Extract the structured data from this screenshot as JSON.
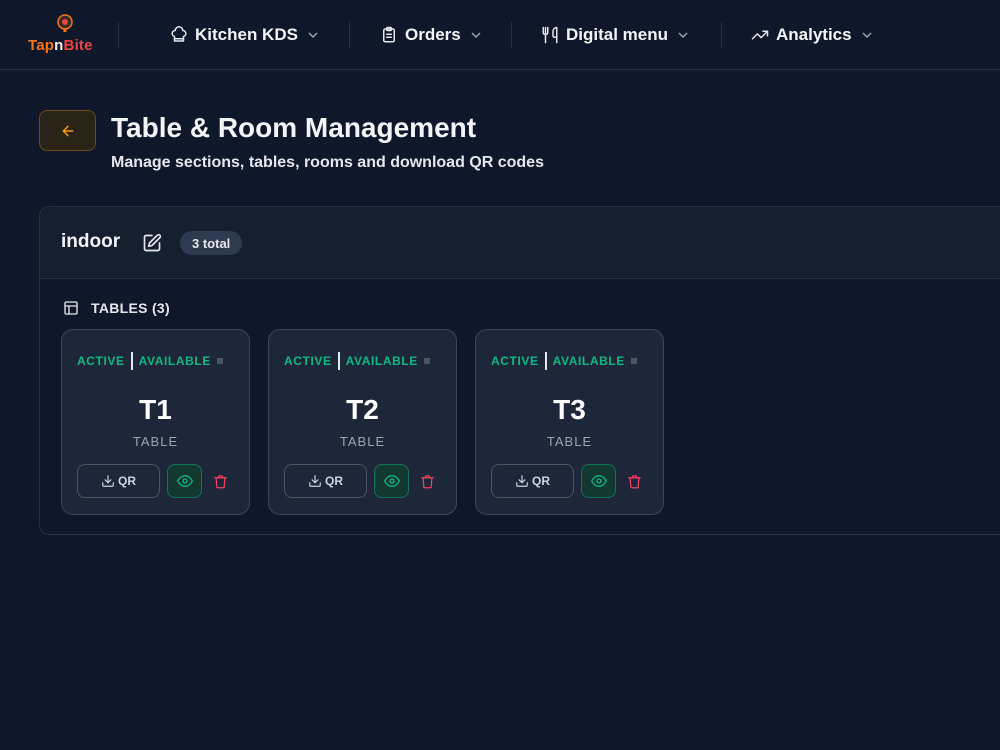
{
  "nav": {
    "logo": {
      "part1": "Tap",
      "part2": "n",
      "part3": "Bite"
    },
    "items": [
      {
        "label": "Kitchen KDS",
        "icon": "chef-hat-icon"
      },
      {
        "label": "Orders",
        "icon": "clipboard-icon"
      },
      {
        "label": "Digital menu",
        "icon": "utensils-icon"
      },
      {
        "label": "Analytics",
        "icon": "trending-up-icon"
      }
    ]
  },
  "header": {
    "title": "Table & Room Management",
    "subtitle": "Manage sections, tables, rooms and download QR codes"
  },
  "section": {
    "name": "indoor",
    "total_badge": "3 total",
    "tables_label": "TABLES (3)",
    "tables": [
      {
        "status": "ACTIVE",
        "availability": "AVAILABLE",
        "name": "T1",
        "type": "TABLE",
        "qr_label": "QR"
      },
      {
        "status": "ACTIVE",
        "availability": "AVAILABLE",
        "name": "T2",
        "type": "TABLE",
        "qr_label": "QR"
      },
      {
        "status": "ACTIVE",
        "availability": "AVAILABLE",
        "name": "T3",
        "type": "TABLE",
        "qr_label": "QR"
      }
    ]
  },
  "colors": {
    "background": "#0f172a",
    "accent_orange": "#f59e0b",
    "status_green": "#10b981",
    "danger_red": "#f43f5e"
  }
}
